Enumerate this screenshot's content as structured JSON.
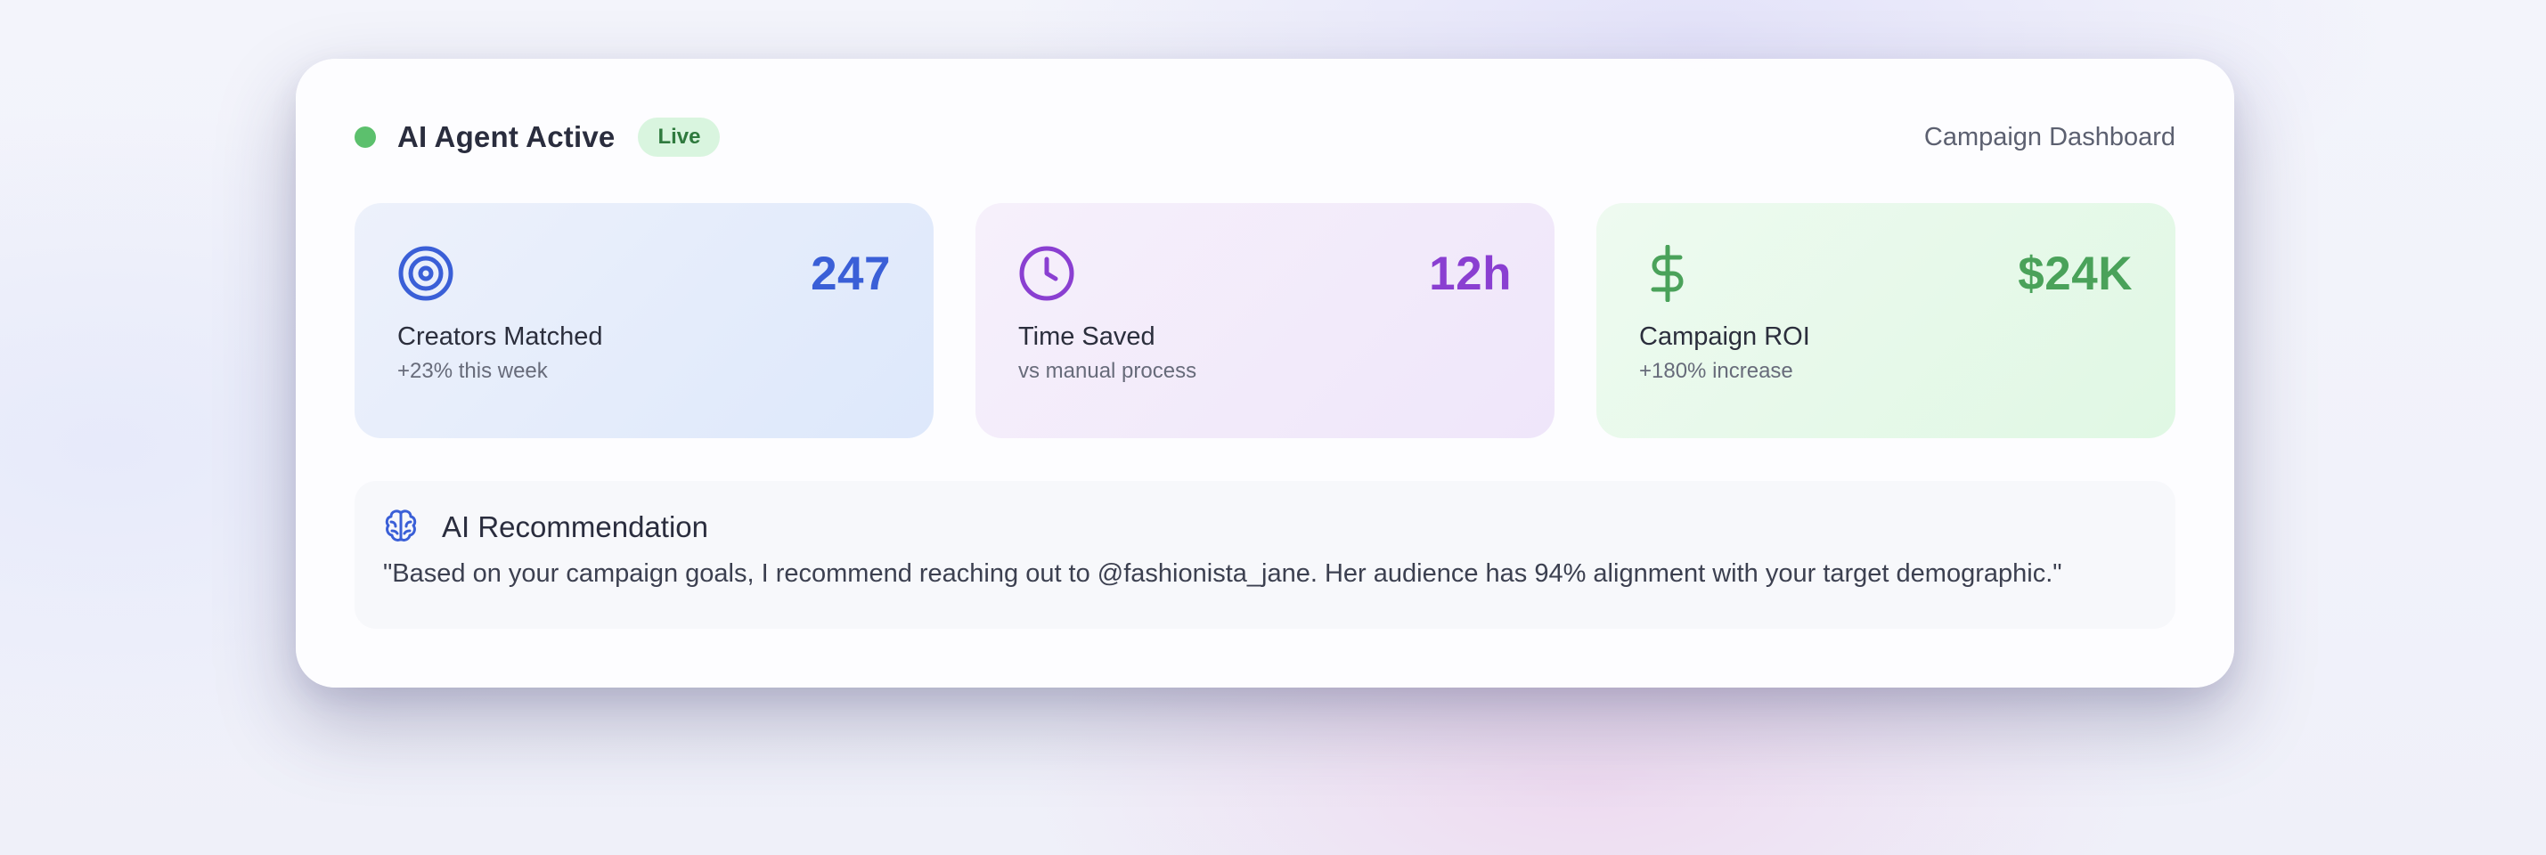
{
  "header": {
    "agent_title": "AI Agent Active",
    "badge": "Live",
    "dashboard_link": "Campaign Dashboard"
  },
  "colors": {
    "status_dot": "#5cc06d",
    "creators_accent": "#3a5fd7",
    "time_accent": "#8a3fd1",
    "roi_accent": "#4aa25a"
  },
  "stats": [
    {
      "icon": "target-icon",
      "value": "247",
      "label": "Creators Matched",
      "sub": "+23% this week"
    },
    {
      "icon": "clock-icon",
      "value": "12h",
      "label": "Time Saved",
      "sub": "vs manual process"
    },
    {
      "icon": "dollar-icon",
      "value": "$24K",
      "label": "Campaign ROI",
      "sub": "+180% increase"
    }
  ],
  "recommendation": {
    "icon": "brain-icon",
    "title": "AI Recommendation",
    "text": "\"Based on your campaign goals, I recommend reaching out to @fashionista_jane. Her audience has 94% alignment with your target demographic.\""
  }
}
